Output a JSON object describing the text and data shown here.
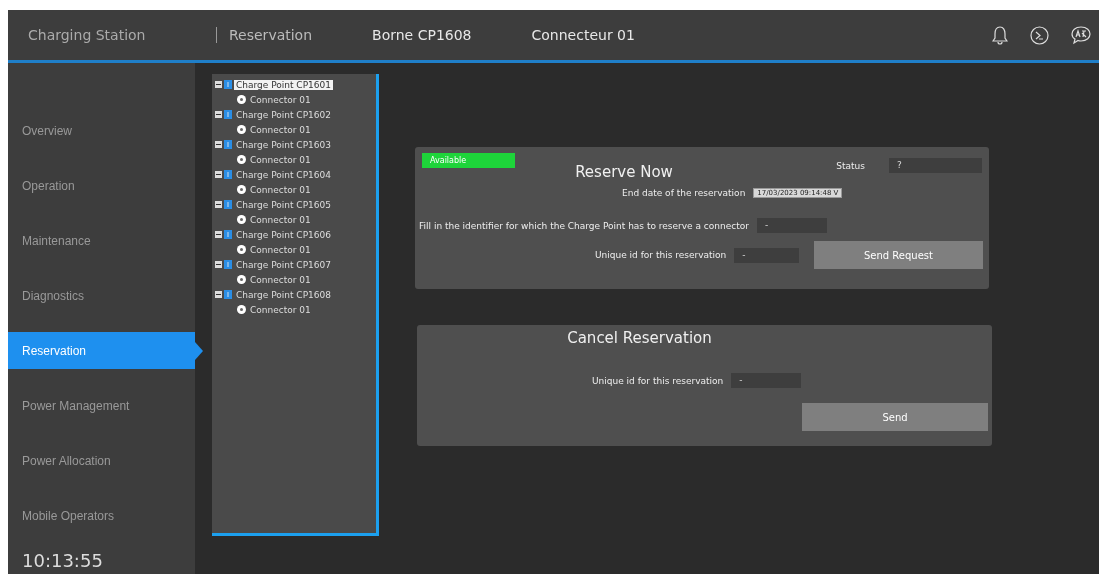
{
  "header": {
    "title": "Charging Station",
    "breadcrumbs": [
      "Reservation",
      "Borne CP1608",
      "Connecteur 01"
    ]
  },
  "sidebar": {
    "items": [
      {
        "label": "Overview",
        "selected": false
      },
      {
        "label": "Operation",
        "selected": false
      },
      {
        "label": "Maintenance",
        "selected": false
      },
      {
        "label": "Diagnostics",
        "selected": false
      },
      {
        "label": "Reservation",
        "selected": true
      },
      {
        "label": "Power Management",
        "selected": false
      },
      {
        "label": "Power Allocation",
        "selected": false
      },
      {
        "label": "Mobile Operators",
        "selected": false
      }
    ],
    "clock": "10:13:55"
  },
  "tree": [
    {
      "label": "Charge Point CP1601",
      "selected": true,
      "expanded": true,
      "children": [
        {
          "label": "Connector 01",
          "selected": false
        }
      ]
    },
    {
      "label": "Charge Point CP1602",
      "selected": false,
      "expanded": true,
      "children": [
        {
          "label": "Connector 01",
          "selected": false
        }
      ]
    },
    {
      "label": "Charge Point CP1603",
      "selected": false,
      "expanded": true,
      "children": [
        {
          "label": "Connector 01",
          "selected": false
        }
      ]
    },
    {
      "label": "Charge Point CP1604",
      "selected": false,
      "expanded": true,
      "children": [
        {
          "label": "Connector 01",
          "selected": false
        }
      ]
    },
    {
      "label": "Charge Point CP1605",
      "selected": false,
      "expanded": true,
      "children": [
        {
          "label": "Connector 01",
          "selected": false
        }
      ]
    },
    {
      "label": "Charge Point CP1606",
      "selected": false,
      "expanded": true,
      "children": [
        {
          "label": "Connector 01",
          "selected": false
        }
      ]
    },
    {
      "label": "Charge Point CP1607",
      "selected": false,
      "expanded": true,
      "children": [
        {
          "label": "Connector 01",
          "selected": false
        }
      ]
    },
    {
      "label": "Charge Point CP1608",
      "selected": false,
      "expanded": true,
      "children": [
        {
          "label": "Connector 01",
          "selected": false
        }
      ]
    }
  ],
  "reserve_now": {
    "availability": "Available",
    "available": true,
    "title": "Reserve Now",
    "status_label": "Status",
    "status_value": "?",
    "end_date_label": "End date of the reservation",
    "end_date_value": "17/03/2023   09:14:48",
    "end_date_caret": "V",
    "identifier_label": "Fill in the identifier for which the Charge Point has to reserve a connector",
    "identifier_value": "-",
    "reservation_id_label": "Unique id for this reservation",
    "reservation_id_value": "-",
    "button": "Send Request"
  },
  "cancel_reservation": {
    "title": "Cancel Reservation",
    "reservation_id_label": "Unique id for this reservation",
    "reservation_id_value": "-",
    "button": "Send"
  }
}
